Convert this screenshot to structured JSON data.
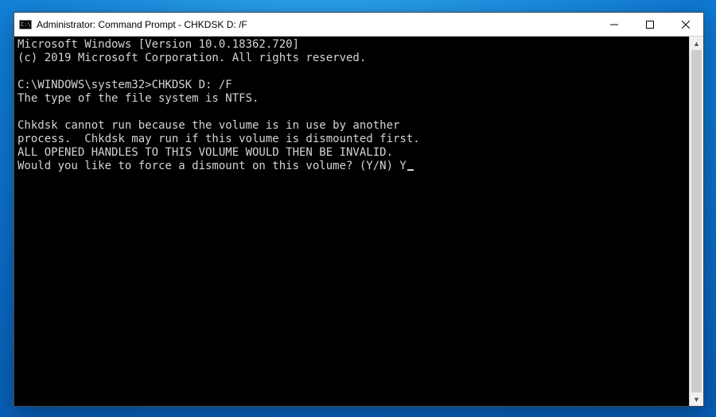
{
  "title": "Administrator: Command Prompt - CHKDSK  D: /F",
  "terminal": {
    "line_version": "Microsoft Windows [Version 10.0.18362.720]",
    "line_copyright": "(c) 2019 Microsoft Corporation. All rights reserved.",
    "blank1": "",
    "line_prompt": "C:\\WINDOWS\\system32>CHKDSK D: /F",
    "line_fs": "The type of the file system is NTFS.",
    "blank2": "",
    "line_busy1": "Chkdsk cannot run because the volume is in use by another",
    "line_busy2": "process.  Chkdsk may run if this volume is dismounted first.",
    "line_warn": "ALL OPENED HANDLES TO THIS VOLUME WOULD THEN BE INVALID.",
    "line_ask": "Would you like to force a dismount on this volume? (Y/N) Y"
  }
}
